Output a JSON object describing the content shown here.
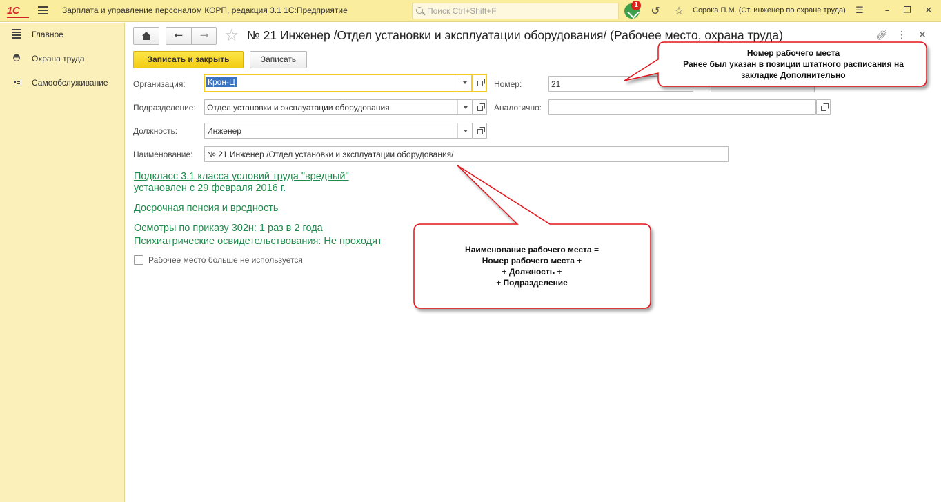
{
  "app": {
    "logo": "1С",
    "title": "Зарплата и управление персоналом КОРП, редакция 3.1 1С:Предприятие",
    "search_placeholder": "Поиск Ctrl+Shift+F",
    "notifications_count": "1",
    "user": "Сорока П.М. (Ст. инженер по охране труда)"
  },
  "sidebar": {
    "items": [
      {
        "label": "Главное",
        "icon": "bars-icon"
      },
      {
        "label": "Охрана труда",
        "icon": "helmet-icon"
      },
      {
        "label": "Самообслуживание",
        "icon": "id-card-icon"
      }
    ]
  },
  "form": {
    "title": "№ 21 Инженер /Отдел установки и эксплуатации оборудования/ (Рабочее место, охрана труда)",
    "save_close_label": "Записать и закрыть",
    "save_label": "Записать",
    "fields": {
      "organization_label": "Организация:",
      "organization_value": "Крон-Ц",
      "number_label": "Номер:",
      "number_value": "21",
      "department_label": "Подразделение:",
      "department_value": "Отдел установки и эксплуатации оборудования",
      "similar_label": "Аналогично:",
      "similar_value": "",
      "position_label": "Должность:",
      "position_value": "Инженер",
      "name_label": "Наименование:",
      "name_value": "№ 21 Инженер /Отдел установки и эксплуатации оборудования/"
    },
    "links": {
      "hazard_line1": "Подкласс 3.1 класса условий труда \"вредный\"",
      "hazard_line2": "установлен с 29 февраля 2016 г.",
      "pension": "Досрочная пенсия и вредность",
      "exams": "Осмотры по приказу 302н: 1 раз в 2 года",
      "psych": "Психиатрические освидетельствования: Не проходят"
    },
    "not_used_label": "Рабочее место больше не используется",
    "not_used_checked": false
  },
  "callouts": {
    "number": {
      "line1": "Номер рабочего места",
      "line2": "Ранее был указан в позиции штатного расписания на",
      "line3": "закладке Дополнительно"
    },
    "name": {
      "line1": "Наименование рабочего места =",
      "line2": "Номер рабочего места +",
      "line3": "+ Должность +",
      "line4": "+ Подразделение"
    },
    "border_color": "#e0121b"
  },
  "colors": {
    "topbar": "#fbed9e",
    "sidebar": "#fbf0b9",
    "primary_button": "#f8d92b",
    "link": "#1e8a4c"
  }
}
